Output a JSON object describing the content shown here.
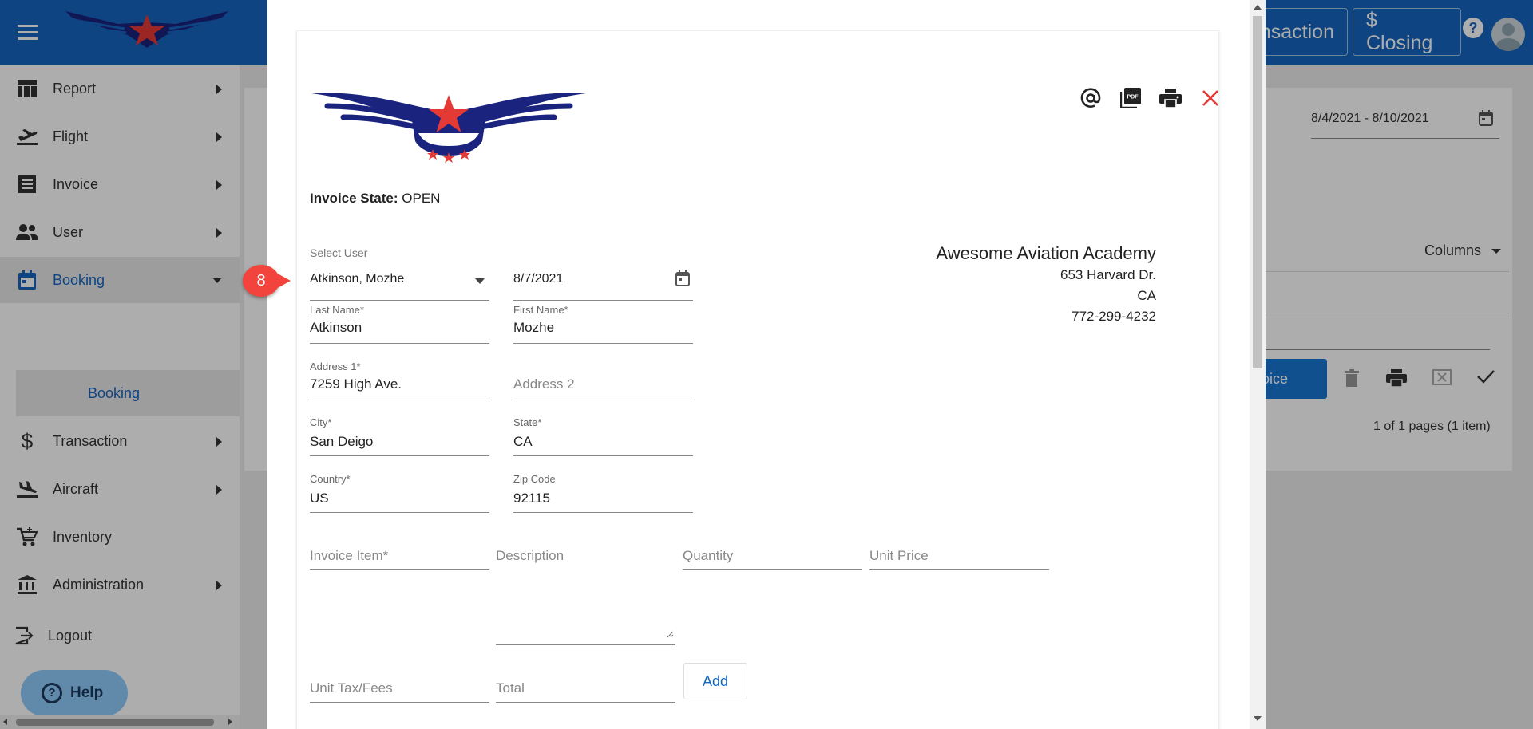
{
  "topbar": {
    "transaction_label": "nsaction",
    "closing_label": "$ Closing",
    "help_label": "?"
  },
  "sidebar": {
    "items": [
      {
        "label": "Report",
        "icon": "report-icon"
      },
      {
        "label": "Flight",
        "icon": "flight-takeoff-icon"
      },
      {
        "label": "Invoice",
        "icon": "invoice-icon"
      },
      {
        "label": "User",
        "icon": "users-icon"
      },
      {
        "label": "Booking",
        "icon": "calendar-icon"
      },
      {
        "label": "Transaction",
        "icon": "dollar-icon"
      },
      {
        "label": "Aircraft",
        "icon": "flight-landing-icon"
      },
      {
        "label": "Inventory",
        "icon": "cart-icon"
      },
      {
        "label": "Administration",
        "icon": "bank-icon"
      },
      {
        "label": "Logout",
        "icon": "logout-icon"
      }
    ],
    "sub_item": "Booking"
  },
  "background": {
    "date_range": "8/4/2021 - 8/10/2021",
    "columns_label": "Columns",
    "invoice_button": "oice",
    "pages": "1 of 1 pages (1 item)"
  },
  "help_button": "Help",
  "step_badge": "8",
  "dialog": {
    "invoice_state_label": "Invoice State:",
    "invoice_state_value": "OPEN",
    "company": {
      "name": "Awesome Aviation Academy",
      "address": "653 Harvard Dr.",
      "state": "CA",
      "phone": "772-299-4232"
    },
    "select_user_label": "Select User",
    "select_user_value": "Atkinson, Mozhe",
    "date_value": "8/7/2021",
    "last_name_label": "Last Name*",
    "last_name_value": "Atkinson",
    "first_name_label": "First Name*",
    "first_name_value": "Mozhe",
    "address1_label": "Address 1*",
    "address1_value": "7259 High Ave.",
    "address2_placeholder": "Address 2",
    "city_label": "City*",
    "city_value": "San Deigo",
    "state_label": "State*",
    "state_value": "CA",
    "country_label": "Country*",
    "country_value": "US",
    "zip_label": "Zip Code",
    "zip_value": "92115",
    "invoice_item_placeholder": "Invoice Item*",
    "description_placeholder": "Description",
    "quantity_placeholder": "Quantity",
    "unit_price_placeholder": "Unit Price",
    "unit_tax_placeholder": "Unit Tax/Fees",
    "total_placeholder": "Total",
    "add_label": "Add"
  },
  "colors": {
    "primary": "#1565c0",
    "close_red": "#e53935",
    "badge_red": "#f2433c",
    "logo_navy": "#1a237e",
    "logo_red": "#e53935"
  }
}
